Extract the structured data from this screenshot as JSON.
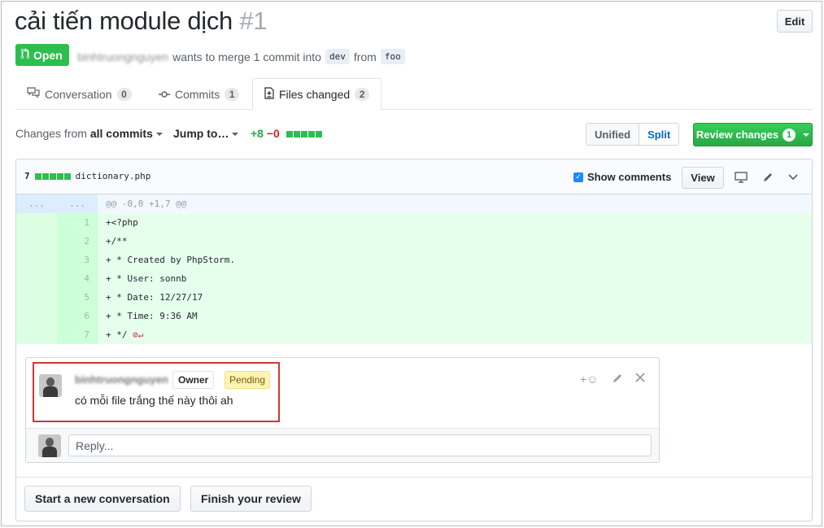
{
  "header": {
    "title": "cải tiến module dịch",
    "number": "#1",
    "edit_label": "Edit",
    "state_label": "Open",
    "author": "binhtruongnguyen",
    "merge_text": "wants to merge 1 commit into",
    "base_branch": "dev",
    "from_text": "from",
    "head_branch": "foo"
  },
  "tabs": [
    {
      "label": "Conversation",
      "count": "0"
    },
    {
      "label": "Commits",
      "count": "1"
    },
    {
      "label": "Files changed",
      "count": "2"
    }
  ],
  "toolbar": {
    "changes_from": "Changes from",
    "changes_scope": "all commits",
    "jump_to": "Jump to…",
    "additions": "+8",
    "deletions": "−0",
    "unified": "Unified",
    "split": "Split",
    "review_label": "Review changes",
    "review_count": "1"
  },
  "file": {
    "change_count": "7",
    "filename": "dictionary.php",
    "show_comments": "Show comments",
    "view_label": "View",
    "hunk_left": "...",
    "hunk_right": "...",
    "hunk_header": "@@ -0,0 +1,7 @@",
    "lines": [
      {
        "num": "1",
        "code": "+<?php"
      },
      {
        "num": "2",
        "code": "+/**"
      },
      {
        "num": "3",
        "code": "+ * Created by PhpStorm."
      },
      {
        "num": "4",
        "code": "+ * User: sonnb"
      },
      {
        "num": "5",
        "code": "+ * Date: 12/27/17"
      },
      {
        "num": "6",
        "code": "+ * Time: 9:36 AM"
      },
      {
        "num": "7",
        "code": "+ */"
      }
    ],
    "no_eol_marker": "⊘↵"
  },
  "comment": {
    "author": "binhtruongnguyen",
    "owner_label": "Owner",
    "pending_label": "Pending",
    "body": "có mỗi file trắng thế này thôi ah",
    "reaction_icon": "+☺",
    "reply_placeholder": "Reply..."
  },
  "footer": {
    "start_conversation": "Start a new conversation",
    "finish_review": "Finish your review"
  },
  "colors": {
    "open_green": "#2cbe4e",
    "add_bg": "#e6ffed",
    "hunk_bg": "#f1f8ff",
    "pending_bg": "#fff5b1",
    "highlight_red": "#d0362f"
  }
}
